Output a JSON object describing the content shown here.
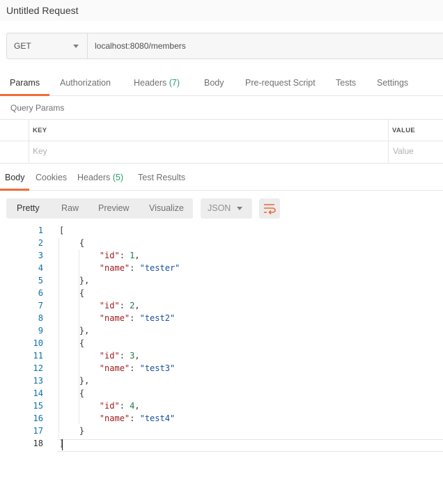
{
  "title": "Untitled Request",
  "request": {
    "method": "GET",
    "url": "localhost:8080/members"
  },
  "request_tabs": [
    {
      "label": "Params",
      "count": "",
      "active": true
    },
    {
      "label": "Authorization",
      "count": "",
      "active": false
    },
    {
      "label": "Headers",
      "count": "(7)",
      "active": false
    },
    {
      "label": "Body",
      "count": "",
      "active": false
    },
    {
      "label": "Pre-request Script",
      "count": "",
      "active": false
    },
    {
      "label": "Tests",
      "count": "",
      "active": false
    },
    {
      "label": "Settings",
      "count": "",
      "active": false
    }
  ],
  "query_params": {
    "section_label": "Query Params",
    "col_key": "KEY",
    "col_value": "VALUE",
    "key_placeholder": "Key",
    "value_placeholder": "Value"
  },
  "response_tabs": [
    {
      "label": "Body",
      "count": "",
      "active": true
    },
    {
      "label": "Cookies",
      "count": "",
      "active": false
    },
    {
      "label": "Headers",
      "count": "(5)",
      "active": false
    },
    {
      "label": "Test Results",
      "count": "",
      "active": false
    }
  ],
  "view_modes": [
    "Pretty",
    "Raw",
    "Preview",
    "Visualize"
  ],
  "active_view": "Pretty",
  "format": "JSON",
  "icons": {
    "method_dropdown": "chevron-down-icon",
    "format_dropdown": "chevron-down-icon",
    "wrap": "wrap-lines-icon"
  },
  "colors": {
    "accent": "#f26b3a",
    "count": "#26a069",
    "line_number": "#0f6fa8",
    "json_key": "#a11d1d",
    "json_number": "#1b7a4a",
    "json_string": "#1a4fa0"
  },
  "response_body": [
    "[",
    "    {",
    "        \"id\": 1,",
    "        \"name\": \"tester\"",
    "    },",
    "    {",
    "        \"id\": 2,",
    "        \"name\": \"test2\"",
    "    },",
    "    {",
    "        \"id\": 3,",
    "        \"name\": \"test3\"",
    "    },",
    "    {",
    "        \"id\": 4,",
    "        \"name\": \"test4\"",
    "    }",
    "]"
  ]
}
